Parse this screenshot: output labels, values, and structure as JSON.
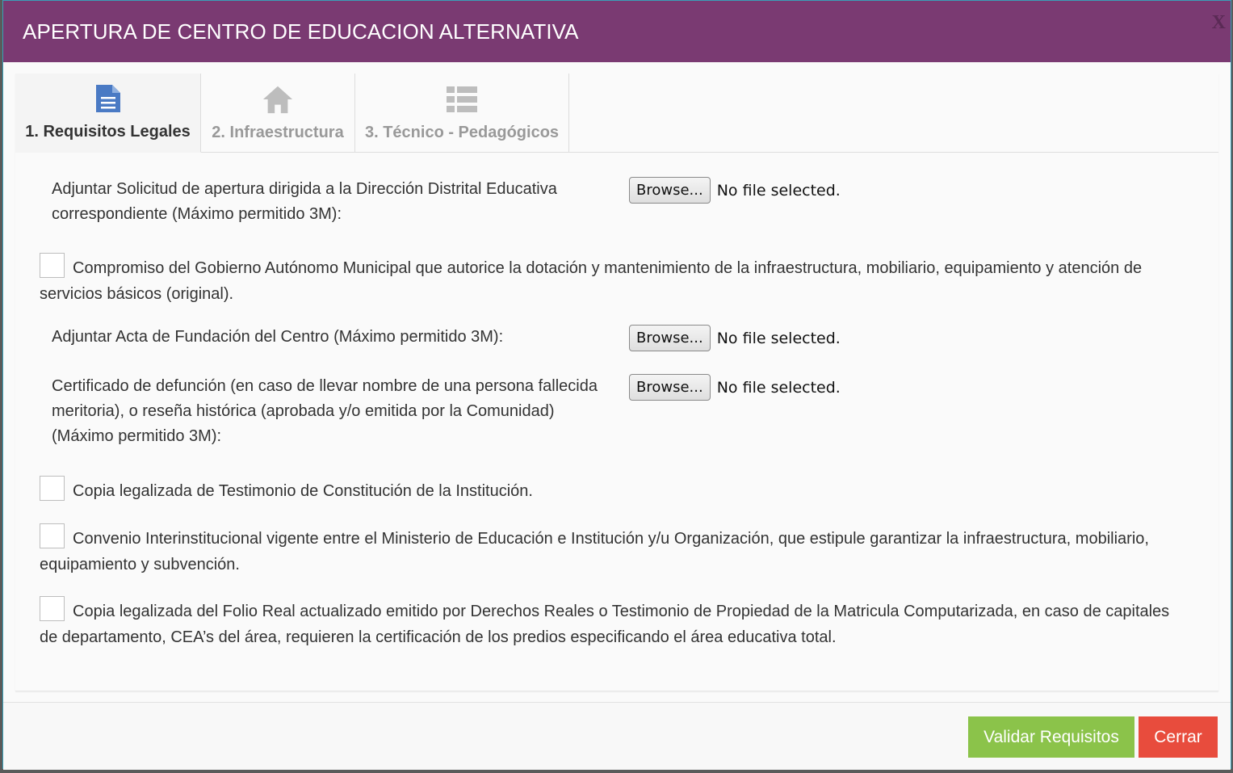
{
  "modal": {
    "title": "APERTURA DE CENTRO DE EDUCACION ALTERNATIVA",
    "close_label": "X"
  },
  "tabs": [
    {
      "label": "1. Requisitos Legales",
      "icon": "document-icon",
      "active": true
    },
    {
      "label": "2. Infraestructura",
      "icon": "home-icon",
      "active": false
    },
    {
      "label": "3. Técnico - Pedagógicos",
      "icon": "list-icon",
      "active": false
    }
  ],
  "requirements": {
    "file1": {
      "label": "Adjuntar Solicitud de apertura dirigida a la Dirección Distrital Educativa correspondiente (Máximo permitido 3M):",
      "button": "Browse...",
      "status": "No file selected."
    },
    "check1": "Compromiso del Gobierno Autónomo Municipal que autorice la dotación y mantenimiento de la infraestructura, mobiliario, equipamiento y atención de servicios básicos (original).",
    "file2": {
      "label": "Adjuntar Acta de Fundación del Centro (Máximo permitido 3M):",
      "button": "Browse...",
      "status": "No file selected."
    },
    "file3": {
      "label": "Certificado de defunción (en caso de llevar nombre de una persona fallecida meritoria), o reseña histórica (aprobada y/o emitida por la Comunidad) (Máximo permitido 3M):",
      "button": "Browse...",
      "status": "No file selected."
    },
    "check2": "Copia legalizada de Testimonio de Constitución de la Institución.",
    "check3": "Convenio Interinstitucional vigente entre el Ministerio de Educación e Institución y/u Organización, que estipule garantizar la infraestructura, mobiliario, equipamiento y subvención.",
    "check4": "Copia legalizada del Folio Real actualizado emitido por Derechos Reales o Testimonio de Propiedad de la Matricula Computarizada, en caso de capitales de departamento, CEA’s del área, requieren la certificación de los predios especificando el área educativa total."
  },
  "footer": {
    "validate_label": "Validar Requisitos",
    "close_label": "Cerrar"
  },
  "colors": {
    "header": "#7a3a72",
    "active_icon": "#4a7ac4",
    "inactive_icon": "#bdbdbd",
    "validate": "#8bc34a",
    "close": "#e84c3d"
  }
}
